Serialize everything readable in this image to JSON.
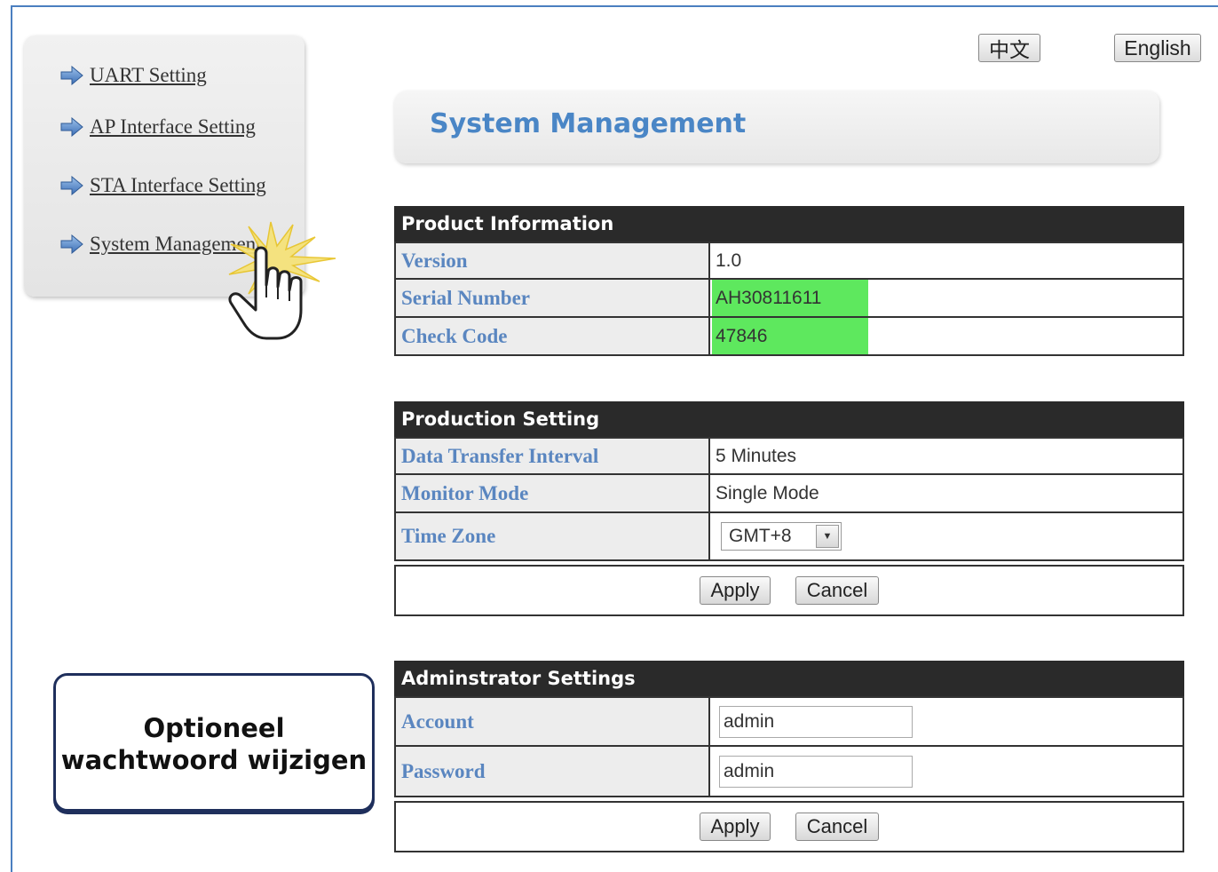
{
  "language": {
    "chinese_label": "中文",
    "english_label": "English"
  },
  "sidebar": {
    "items": [
      {
        "label": "UART Setting",
        "icon": "arrow-right-icon"
      },
      {
        "label": "AP Interface Setting",
        "icon": "arrow-right-icon"
      },
      {
        "label": "STA Interface Setting",
        "icon": "arrow-right-icon"
      },
      {
        "label": "System Management",
        "icon": "arrow-right-icon"
      }
    ]
  },
  "page": {
    "title": "System Management"
  },
  "product_information": {
    "header": "Product Information",
    "rows": [
      {
        "label": "Version",
        "value": "1.0"
      },
      {
        "label": "Serial Number",
        "value": "AH30811611"
      },
      {
        "label": "Check Code",
        "value": "47846"
      }
    ],
    "highlight_color": "#5ee85e"
  },
  "production_setting": {
    "header": "Production Setting",
    "rows": [
      {
        "label": "Data Transfer Interval",
        "value": "5 Minutes"
      },
      {
        "label": "Monitor Mode",
        "value": "Single Mode"
      },
      {
        "label": "Time Zone",
        "value": "GMT+8"
      }
    ],
    "apply_label": "Apply",
    "cancel_label": "Cancel"
  },
  "administrator_settings": {
    "header": "Adminstrator Settings",
    "rows": [
      {
        "label": "Account",
        "value": "admin"
      },
      {
        "label": "Password",
        "value": "admin"
      }
    ],
    "apply_label": "Apply",
    "cancel_label": "Cancel"
  },
  "callout": {
    "line1": "Optioneel",
    "line2": "wachtwoord wijzigen"
  },
  "colors": {
    "accent_blue": "#4a86c6",
    "header_dark": "#2a2a2a"
  }
}
